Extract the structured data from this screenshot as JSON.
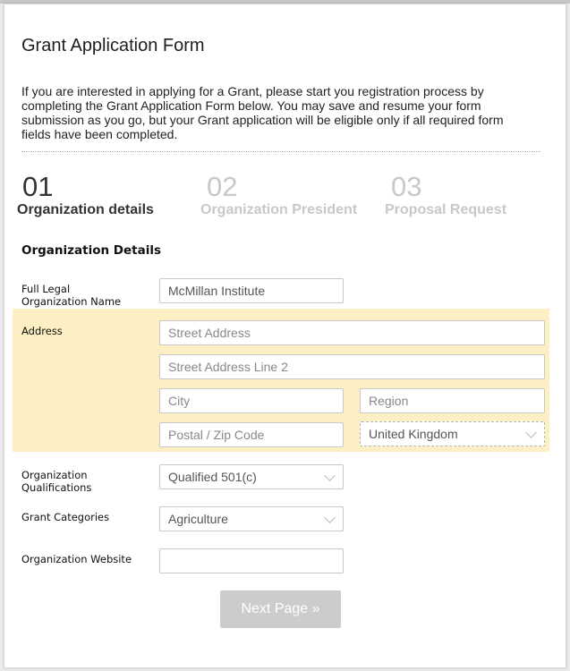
{
  "form": {
    "title": "Grant Application Form",
    "intro": "If you are interested in applying for a Grant, please start you registration process by completing the Grant Application Form below. You may save and resume your form submission as you go, but your Grant application will be eligible only if all required form fields have been completed."
  },
  "steps": [
    {
      "number": "01",
      "label": "Organization details",
      "state": "active"
    },
    {
      "number": "02",
      "label": "Organization President",
      "state": "inactive"
    },
    {
      "number": "03",
      "label": "Proposal Request",
      "state": "inactive"
    }
  ],
  "section": {
    "title": "Organization Details"
  },
  "fields": {
    "org_name": {
      "label": "Full Legal Organization Name",
      "value": "McMillan Institute"
    },
    "address": {
      "label": "Address",
      "street_placeholder": "Street Address",
      "street2_placeholder": "Street Address Line 2",
      "city_placeholder": "City",
      "region_placeholder": "Region",
      "postal_placeholder": "Postal / Zip Code",
      "country_value": "United Kingdom"
    },
    "qualifications": {
      "label": "Organization Qualifications",
      "value": "Qualified 501(c)"
    },
    "categories": {
      "label": "Grant Categories",
      "value": "Agriculture"
    },
    "website": {
      "label": "Organization Website",
      "value": ""
    }
  },
  "buttons": {
    "next": "Next Page »"
  },
  "colors": {
    "highlight": "#fcefc3",
    "button_disabled": "#cccccc"
  }
}
